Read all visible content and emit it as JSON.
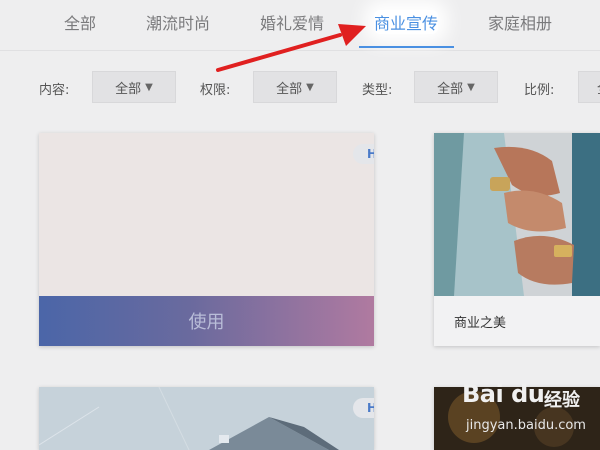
{
  "tabs": [
    {
      "label": "全部"
    },
    {
      "label": "潮流时尚"
    },
    {
      "label": "婚礼爱情"
    },
    {
      "label": "商业宣传"
    },
    {
      "label": "家庭相册"
    }
  ],
  "filters": {
    "content_label": "内容:",
    "content_value": "全部",
    "permission_label": "权限:",
    "permission_value": "全部",
    "type_label": "类型:",
    "type_value": "全部",
    "ratio_label": "比例:",
    "ratio_value": "全"
  },
  "cards": [
    {
      "badge": "HD",
      "action": "使用"
    },
    {
      "caption": "商业之美"
    },
    {
      "badge": "HD"
    }
  ],
  "watermark": {
    "logo": "Bai du",
    "text": "经验",
    "url": "jingyan.baidu.com"
  },
  "colors": {
    "active_tab": "#4a90e2",
    "arrow": "#e02020"
  }
}
